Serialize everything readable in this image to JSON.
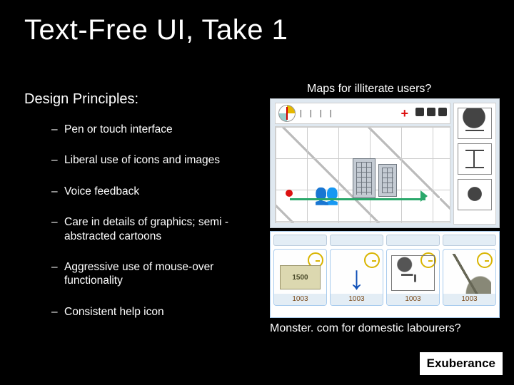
{
  "title": "Text-Free UI, Take 1",
  "subhead": "Design Principles:",
  "bullets": [
    "Pen or touch interface",
    "Liberal use of icons and images",
    "Voice feedback",
    "Care in details of graphics; semi -abstracted cartoons",
    "Aggressive use of mouse-over functionality",
    "Consistent help icon"
  ],
  "caption_top": "Maps for illiterate users?",
  "caption_bottom": "Monster. com for domestic labourers?",
  "footer": "Exuberance",
  "mock2": {
    "money_label": "1500",
    "prices": [
      "1003",
      "1003",
      "1003",
      "1003"
    ]
  }
}
